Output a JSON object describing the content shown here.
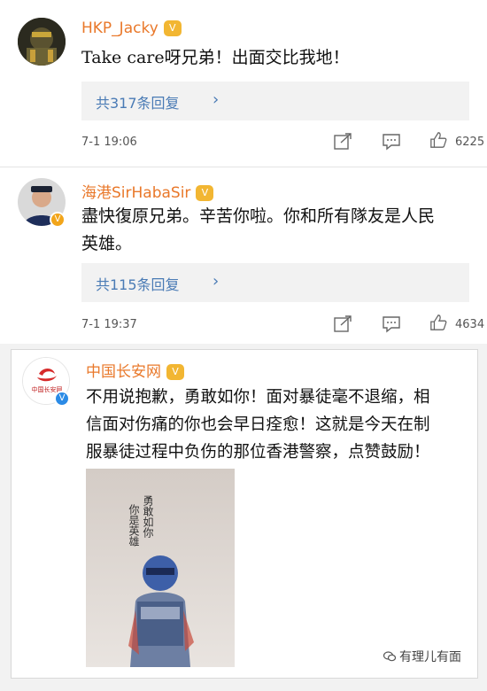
{
  "comments": [
    {
      "username": "HKP_Jacky",
      "text": "Take care呀兄弟！出面交比我地！",
      "replies": "共317条回复",
      "date": "7-1 19:06",
      "likes": "6225"
    },
    {
      "username": "海港SirHabaSir",
      "text_line1": "盡快復原兄弟。辛苦你啦。你和所有隊友是人民",
      "text_line2": "英雄。",
      "replies": "共115条回复",
      "date": "7-1 19:37",
      "likes": "4634"
    },
    {
      "username": "中国长安网",
      "avatar_label": "中国长安网",
      "text_line1": "不用说抱歉，勇敢如你！面对暴徒毫不退缩，相",
      "text_line2": "信面对伤痛的你也会早日痊愈！这就是今天在制",
      "text_line3": "服暴徒过程中负伤的那位香港警察，点赞鼓励！",
      "image_caption_col1": "勇敢如你",
      "image_caption_col2": "你是英雄"
    }
  ],
  "watermark": "有理儿有面",
  "icons": {
    "vip": "v-vip-icon",
    "share": "share-icon",
    "comment": "comment-icon",
    "like": "thumbs-up-icon",
    "chevron": "chevron-right-icon"
  },
  "colors": {
    "username": "#e9782a",
    "link": "#4a7bb5",
    "vip": "#f2b632"
  }
}
